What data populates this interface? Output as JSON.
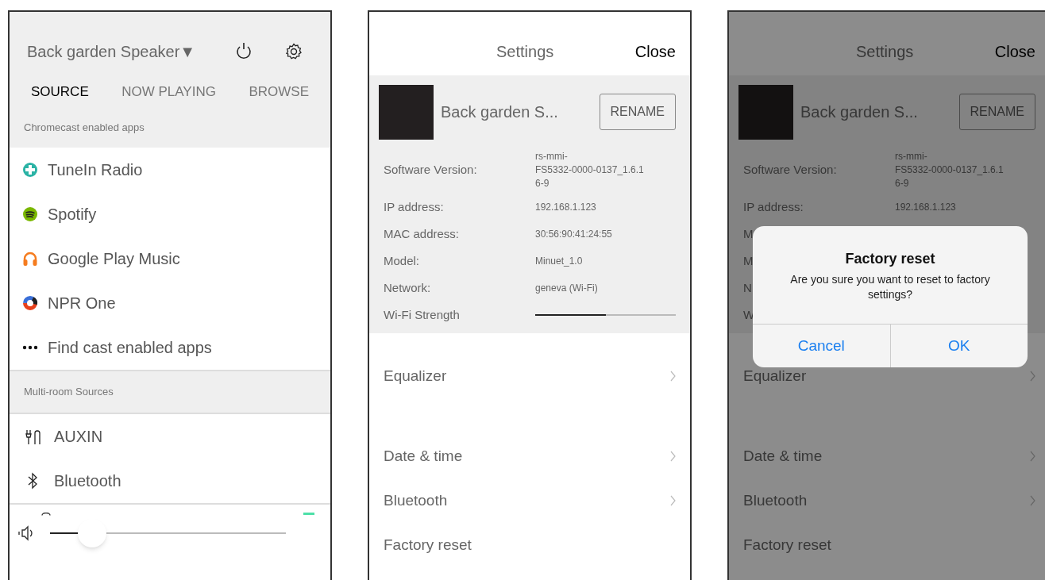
{
  "source_screen": {
    "device_title": "Back garden Speaker▼",
    "tabs": [
      {
        "label": "SOURCE",
        "selected": true
      },
      {
        "label": "NOW PLAYING",
        "selected": false
      },
      {
        "label": "BROWSE",
        "selected": false
      }
    ],
    "cast_section": {
      "header": "Chromecast enabled apps",
      "items": [
        "TuneIn Radio",
        "Spotify",
        "Google Play Music",
        "NPR One",
        "Find cast enabled apps"
      ]
    },
    "multiroom_section": {
      "header": "Multi-room Sources",
      "items": [
        "AUXIN",
        "Bluetooth"
      ]
    },
    "volume": {
      "level": 0.18
    }
  },
  "settings_screen": {
    "title": "Settings",
    "close": "Close",
    "device_name": "Back garden S...",
    "rename": "RENAME",
    "info": [
      {
        "label": "Software Version:",
        "value_lines": [
          "rs-mmi-",
          "FS5332-0000-0137_1.6.1",
          "6-9"
        ]
      },
      {
        "label": "IP address:",
        "value_lines": [
          "192.168.1.123"
        ]
      },
      {
        "label": "MAC address:",
        "value_lines": [
          "30:56:90:41:24:55"
        ]
      },
      {
        "label": "Model:",
        "value_lines": [
          "Minuet_1.0"
        ]
      },
      {
        "label": "Network:",
        "value_lines": [
          "geneva (Wi-Fi)"
        ]
      }
    ],
    "wifi": {
      "label": "Wi-Fi Strength",
      "level": 0.5
    },
    "menu": [
      {
        "label": "Equalizer",
        "chevron": true
      },
      {
        "label": "Date & time",
        "chevron": true
      },
      {
        "label": "Bluetooth",
        "chevron": true
      },
      {
        "label": "Factory reset",
        "chevron": false
      }
    ]
  },
  "reset_screen": {
    "title": "Settings",
    "close": "Close",
    "device_name": "Back garden S...",
    "rename": "RENAME",
    "info": [
      {
        "label": "Software Version:",
        "value_lines": [
          "rs-mmi-",
          "FS5332-0000-0137_1.6.1",
          "6-9"
        ]
      },
      {
        "label": "IP address:",
        "value_lines": [
          "192.168.1.123"
        ]
      },
      {
        "label": "M"
      },
      {
        "label": "M"
      },
      {
        "label": "N"
      },
      {
        "label": "W"
      }
    ],
    "menu": [
      {
        "label": "Equalizer",
        "chevron": true
      },
      {
        "label": "Date & time",
        "chevron": true
      },
      {
        "label": "Bluetooth",
        "chevron": true
      },
      {
        "label": "Factory reset",
        "chevron": false
      }
    ],
    "dialog": {
      "title": "Factory reset",
      "message": "Are you sure you want to reset to factory settings?",
      "buttons": [
        "Cancel",
        "OK"
      ]
    }
  }
}
